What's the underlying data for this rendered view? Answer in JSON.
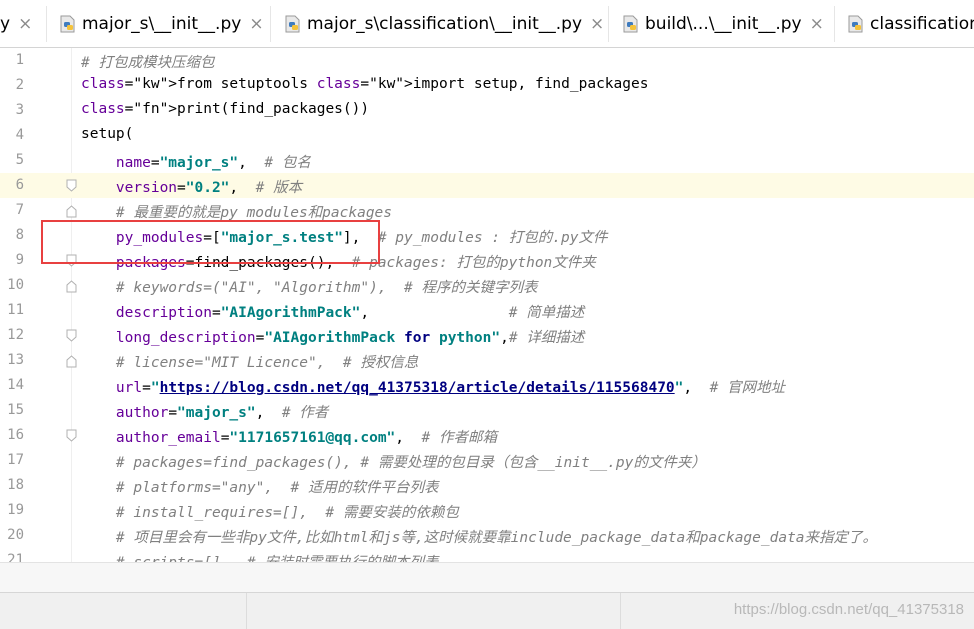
{
  "tabs": [
    {
      "label": "y",
      "close": "×",
      "icon": "close-icon"
    },
    {
      "label": "major_s\\__init__.py",
      "close": "×",
      "icon": "python-file-icon"
    },
    {
      "label": "major_s\\classification\\__init__.py",
      "close": "×",
      "icon": "python-file-icon"
    },
    {
      "label": "build\\...\\__init__.py",
      "close": "×",
      "icon": "python-file-icon"
    },
    {
      "label": "classification",
      "icon": "python-file-icon"
    }
  ],
  "editor": {
    "current_line": 6,
    "lines": [
      {
        "n": "1",
        "text": "# 打包成模块压缩包"
      },
      {
        "n": "2",
        "text": "from setuptools import setup, find_packages"
      },
      {
        "n": "3",
        "text": "print(find_packages())"
      },
      {
        "n": "4",
        "text": "setup("
      },
      {
        "n": "5",
        "text": "    name=\"major_s\",  # 包名"
      },
      {
        "n": "6",
        "text": "    version=\"0.2\",  # 版本"
      },
      {
        "n": "7",
        "text": "    # 最重要的就是py_modules和packages"
      },
      {
        "n": "8",
        "text": "    py_modules=[\"major_s.test\"],  # py_modules : 打包的.py文件"
      },
      {
        "n": "9",
        "text": "    packages=find_packages(),  # packages: 打包的python文件夹"
      },
      {
        "n": "10",
        "text": "    # keywords=(\"AI\", \"Algorithm\"),  # 程序的关键字列表"
      },
      {
        "n": "11",
        "text": "    description=\"AIAgorithmPack\",                # 简单描述"
      },
      {
        "n": "12",
        "text": "    long_description=\"AIAgorithmPack for python\",# 详细描述"
      },
      {
        "n": "13",
        "text": "    # license=\"MIT Licence\",  # 授权信息"
      },
      {
        "n": "14",
        "text": "    url=\"https://blog.csdn.net/qq_41375318/article/details/115568470\",  # 官网地址"
      },
      {
        "n": "15",
        "text": "    author=\"major_s\",  # 作者"
      },
      {
        "n": "16",
        "text": "    author_email=\"1171657161@qq.com\",  # 作者邮箱"
      },
      {
        "n": "17",
        "text": "    # packages=find_packages(), # 需要处理的包目录（包含__init__.py的文件夹）"
      },
      {
        "n": "18",
        "text": "    # platforms=\"any\",  # 适用的软件平台列表"
      },
      {
        "n": "19",
        "text": "    # install_requires=[],  # 需要安装的依赖包"
      },
      {
        "n": "20",
        "text": "    # 项目里会有一些非py文件,比如html和js等,这时候就要靠include_package_data和package_data来指定了。"
      },
      {
        "n": "21",
        "text": "    # scripts=[],  # 安装时需要执行的脚本列表"
      }
    ]
  },
  "watermark": "https://blog.csdn.net/qq_41375318",
  "colors": {
    "keyword": "#000080",
    "string": "#008080",
    "comment": "#808080",
    "param": "#660099",
    "current_line": "#fefbe5",
    "annotation_box": "#e84040"
  }
}
